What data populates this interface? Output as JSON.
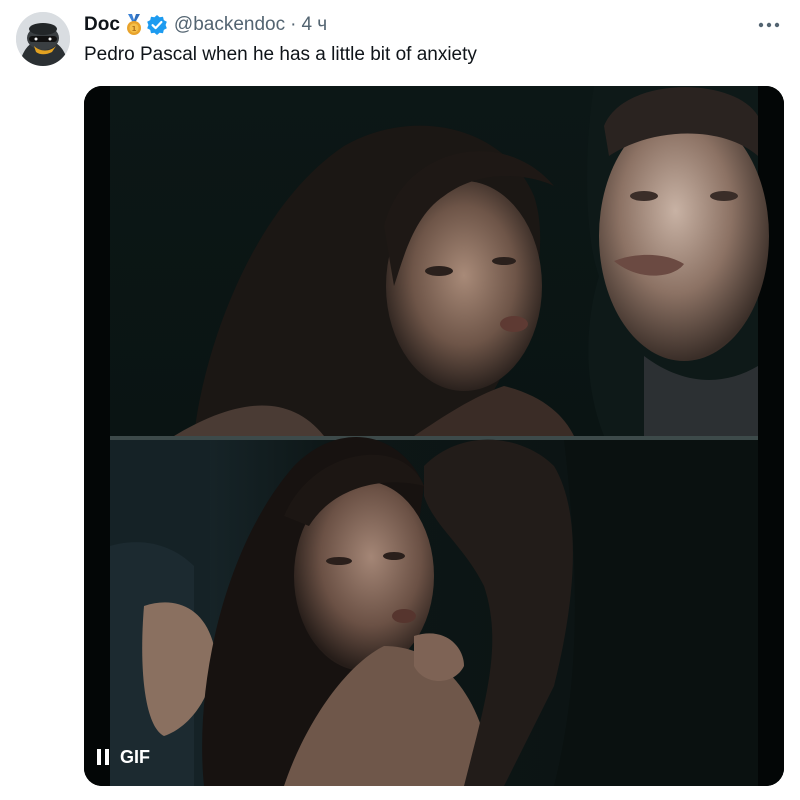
{
  "author": {
    "display_name": "Doc",
    "handle": "@backendoc",
    "separator": "·",
    "time": "4 ч"
  },
  "icons": {
    "medal": "medal-icon",
    "verified": "verified-icon",
    "more": "more-icon",
    "pause": "pause-icon"
  },
  "tweet": {
    "text": "Pedro Pascal when he has a little bit of anxiety"
  },
  "media": {
    "badge_label": "GIF"
  },
  "colors": {
    "verified_blue": "#1d9bf0",
    "secondary_text": "#536471",
    "medal_gold": "#e8a32c"
  }
}
